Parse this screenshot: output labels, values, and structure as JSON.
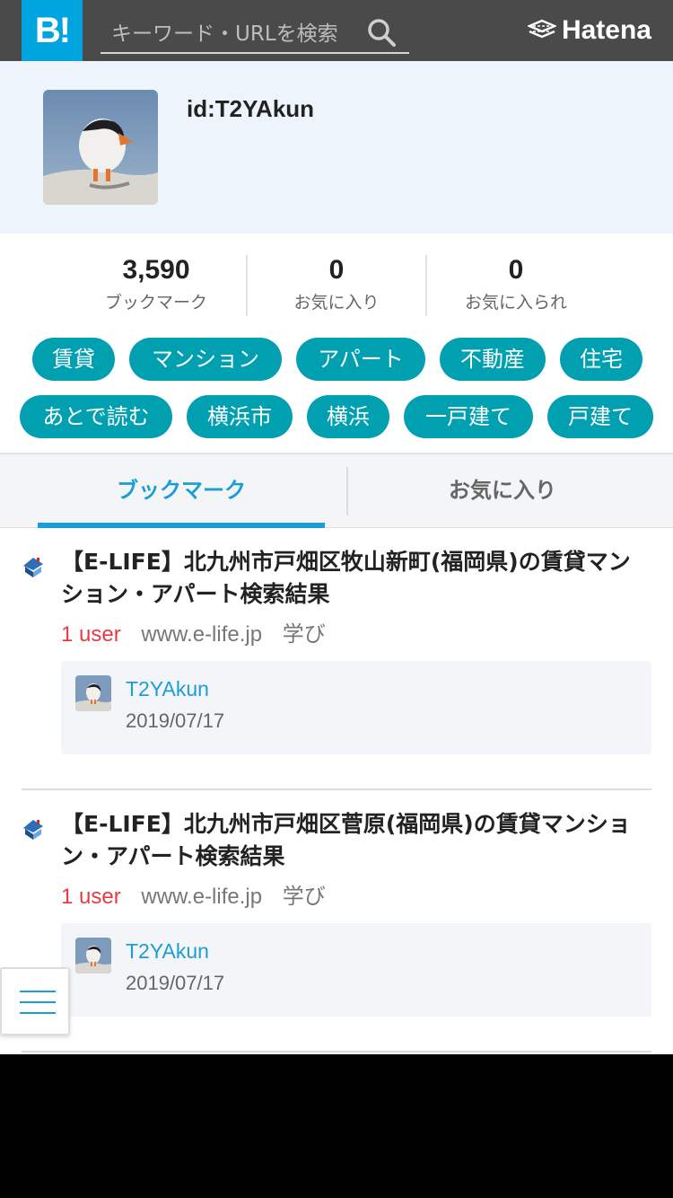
{
  "header": {
    "logo_text": "B!",
    "search_placeholder": "キーワード・URLを検索",
    "brand": "Hatena",
    "bg_color": "#4a4a4a",
    "logo_color": "#00a4de"
  },
  "profile": {
    "user_id": "id:T2YAkun"
  },
  "stats": [
    {
      "value": "3,590",
      "label": "ブックマーク"
    },
    {
      "value": "0",
      "label": "お気に入り"
    },
    {
      "value": "0",
      "label": "お気に入られ"
    }
  ],
  "tags": {
    "color": "#00a0b0",
    "row1": [
      "賃貸",
      "マンション",
      "アパート",
      "不動産",
      "住宅"
    ],
    "row2": [
      "あとで読む",
      "横浜市",
      "横浜",
      "一戸建て",
      "戸建て"
    ]
  },
  "tabs": [
    {
      "label": "ブックマーク",
      "active": true
    },
    {
      "label": "お気に入り",
      "active": false
    }
  ],
  "entries": [
    {
      "title": "【E-LIFE】北九州市戸畑区牧山新町(福岡県)の賃貸マンション・アパート検索結果",
      "users": "1 user",
      "domain": "www.e-life.jp",
      "category": "学び",
      "bookmark": {
        "user": "T2YAkun",
        "date": "2019/07/17"
      }
    },
    {
      "title": "【E-LIFE】北九州市戸畑区菅原(福岡県)の賃貸マンション・アパート検索結果",
      "users": "1 user",
      "domain": "www.e-life.jp",
      "category": "学び",
      "bookmark": {
        "user": "T2YAkun",
        "date": "2019/07/17"
      }
    }
  ],
  "icons": {
    "search": "search-icon",
    "brand": "hatena-mark-icon",
    "favicon": "house-icon",
    "menu": "hamburger-menu-icon"
  },
  "colors": {
    "accent": "#1a9ed6",
    "users_red": "#e53b43",
    "profile_bg": "#eef4fb"
  }
}
